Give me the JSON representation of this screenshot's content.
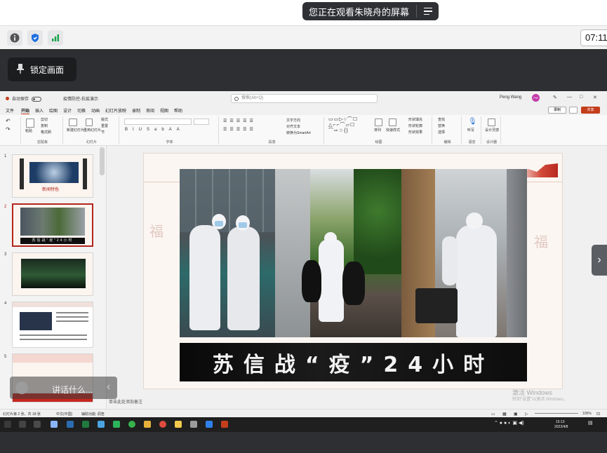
{
  "meeting": {
    "share_banner": "您正在观看朱晓舟的屏幕",
    "timer": "07:11",
    "lock_button": "锁定画面",
    "overlay_text": "讲话什么...",
    "icons": [
      "info-icon",
      "shield-icon",
      "signal-icon",
      "menu-icon",
      "pin-icon",
      "chevron-left-icon",
      "chevron-right-icon"
    ]
  },
  "ppt": {
    "autosave": "自动保存",
    "doc_name": "疫情防控-抗疫演示",
    "search_placeholder": "搜索(Alt+Q)",
    "user_name": "Peng Wang",
    "user_initials": "PW",
    "window_controls": [
      "—",
      "□",
      "✕"
    ],
    "menu_tabs": [
      "文件",
      "开始",
      "插入",
      "绘图",
      "设计",
      "切换",
      "动画",
      "幻灯片放映",
      "录制",
      "审阅",
      "视图",
      "帮助"
    ],
    "active_tab": "开始",
    "record_label": "录制",
    "share_label": "共享",
    "ribbon_groups": [
      "剪贴板",
      "幻灯片",
      "字体",
      "段落",
      "绘图",
      "编辑",
      "语音",
      "设计器"
    ],
    "ribbon_items": {
      "paste": "粘贴",
      "cut": "剪切",
      "copy": "复制",
      "format_painter": "格式刷",
      "new_slide": "新建幻灯片",
      "reuse_slides": "重用幻灯片",
      "layout": "版式",
      "reset": "重置",
      "section": "节",
      "text_direction": "文字方向",
      "align_text": "对齐文本",
      "smartart": "转换为SmartArt",
      "arrange": "排列",
      "quick_styles": "快速样式",
      "shape_fill": "形状填充",
      "shape_outline": "形状轮廓",
      "shape_effects": "形状效果",
      "find": "查找",
      "replace": "替换",
      "select": "选择",
      "dictate": "听写",
      "designer": "设计灵感"
    },
    "slide_numbers": [
      "1",
      "2",
      "3",
      "4",
      "5"
    ],
    "selected_slide": "2",
    "thumb1_title": "新闻特色",
    "main_caption": "苏信战“疫”24小时",
    "thumb2_caption": "苏信战“疫”24小时",
    "decor_char": "福",
    "notes_placeholder": "单击此处添加备注",
    "status_left": "幻灯片第 2 张，共 18 张",
    "status_lang": "中文(中国)",
    "status_access": "辅助功能: 调查",
    "zoom": "105%",
    "activate_windows": "激活 Windows",
    "activate_windows_sub": "转到\"设置\"以激活 Windows。",
    "clock_time": "15:13",
    "clock_date": "2022/4/8"
  }
}
